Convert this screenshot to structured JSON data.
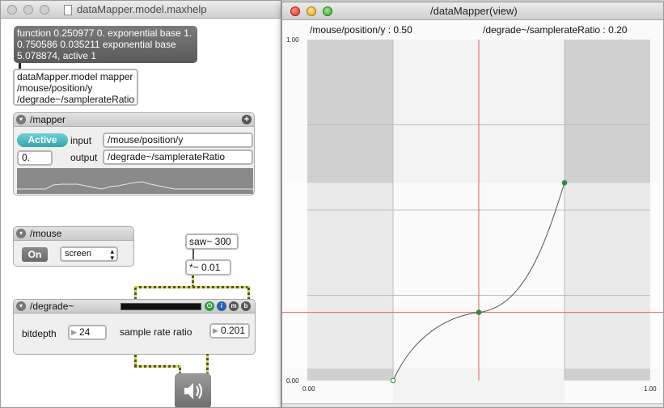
{
  "left_window": {
    "title": "dataMapper.model.maxhelp",
    "message_box": "function 0.250977 0. exponential base 1. 0.750586 0.035211 exponential base 5.078874, active 1",
    "model_object_lines": [
      "dataMapper.model mapper",
      "/mouse/position/y",
      "/degrade~/samplerateRatio"
    ],
    "mapper_panel": {
      "title": "/mapper",
      "active_label": "Active",
      "input_label": "input",
      "input_value": "/mouse/position/y",
      "number_value": "0.",
      "output_label": "output",
      "output_value": "/degrade~/samplerateRatio"
    },
    "mouse_panel": {
      "title": "/mouse",
      "on_label": "On",
      "mode_value": "screen"
    },
    "saw_object": "saw~ 300",
    "mult_object": "*~ 0.01",
    "degrade_panel": {
      "title": "/degrade~",
      "bitdepth_label": "bitdepth",
      "bitdepth_value": "24",
      "ratio_label": "sample rate ratio",
      "ratio_value": "0.201",
      "icon_letters": [
        "m",
        "b"
      ]
    }
  },
  "right_window": {
    "title": "/dataMapper(view)",
    "input_readout": "/mouse/position/y : 0.50",
    "output_readout": "/degrade~/samplerateRatio : 0.20",
    "y_max_label": "1.00",
    "y_min_label": "0.00",
    "x_min_label": "0.00",
    "x_max_label": "1.00",
    "cursor_x": 0.5,
    "cursor_y": 0.2,
    "active_range_x": [
      0.25,
      0.75
    ],
    "active_range_y": [
      0.035,
      0.58
    ],
    "curve_points": [
      [
        0.25,
        0.0
      ],
      [
        0.5,
        0.2
      ],
      [
        0.75,
        0.58
      ]
    ],
    "colors": {
      "curve": "#555555",
      "point": "#2e8b3e",
      "cursor": "#e06060"
    }
  }
}
